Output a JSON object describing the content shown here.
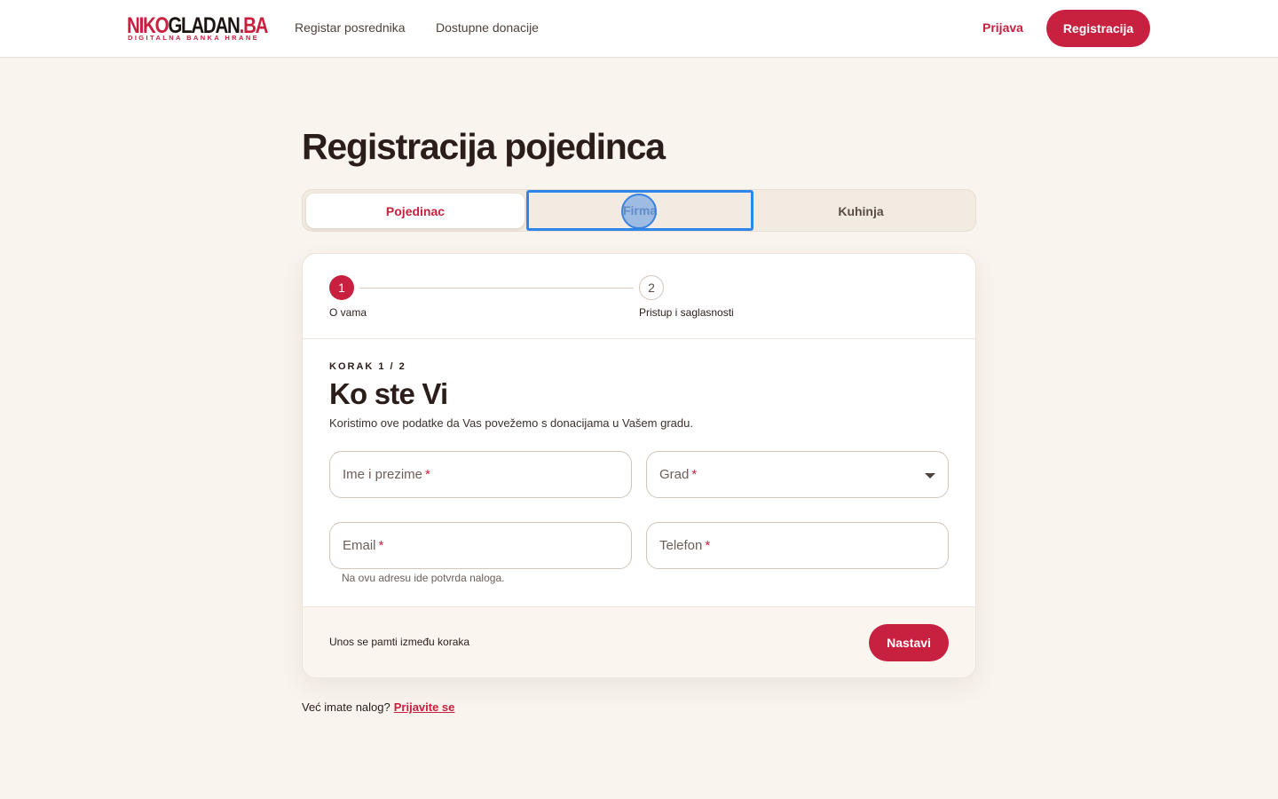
{
  "header": {
    "logo": {
      "part1": "NIKO",
      "part2": "GLADAN",
      "part3": ".BA",
      "tagline": "DIGITALNA BANKA HRANE"
    },
    "nav": [
      "Registar posrednika",
      "Dostupne donacije"
    ],
    "login_label": "Prijava",
    "register_label": "Registracija"
  },
  "page": {
    "title": "Registracija pojedinca"
  },
  "tabs": [
    "Pojedinac",
    "Firma",
    "Kuhinja"
  ],
  "stepper": {
    "steps": [
      {
        "number": "1",
        "label": "O vama"
      },
      {
        "number": "2",
        "label": "Pristup i saglasnosti"
      }
    ]
  },
  "form": {
    "eyebrow": "KORAK 1 / 2",
    "title": "Ko ste Vi",
    "description": "Koristimo ove podatke da Vas povežemo s donacijama u Vašem gradu.",
    "fields": {
      "name": {
        "label": "Ime i prezime",
        "required_mark": "*"
      },
      "city": {
        "label": "Grad",
        "required_mark": "*"
      },
      "email": {
        "label": "Email",
        "required_mark": "*",
        "helper": "Na ovu adresu ide potvrda naloga."
      },
      "phone": {
        "label": "Telefon",
        "required_mark": "*"
      }
    }
  },
  "footer": {
    "note": "Unos se pamti između koraka",
    "next_label": "Nastavi"
  },
  "bottom": {
    "text": "Već imate nalog?",
    "link": "Prijavite se"
  },
  "colors": {
    "accent": "#c8203f",
    "background": "#f9f4ee",
    "focus": "#2e86ea"
  }
}
